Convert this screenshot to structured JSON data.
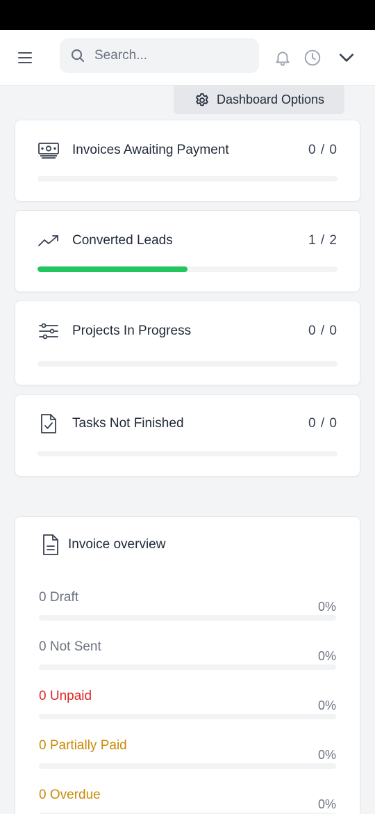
{
  "header": {
    "search_placeholder": "Search...",
    "icons": [
      "menu-icon",
      "search-icon",
      "bell-icon",
      "clock-icon",
      "chevron-down-icon"
    ]
  },
  "dashboard_options": {
    "label": "Dashboard Options",
    "icon": "gear-icon"
  },
  "stats": [
    {
      "label": "Invoices Awaiting Payment",
      "value": "0 / 0",
      "progress": 0,
      "icon": "money-icon"
    },
    {
      "label": "Converted Leads",
      "value": "1 / 2",
      "progress": 0.5,
      "icon": "trending-up-icon",
      "color": "#22c55e"
    },
    {
      "label": "Projects In Progress",
      "value": "0 / 0",
      "progress": 0,
      "icon": "sliders-icon"
    },
    {
      "label": "Tasks Not Finished",
      "value": "0 / 0",
      "progress": 0,
      "icon": "task-file-icon"
    }
  ],
  "invoice_overview": {
    "title": "Invoice overview",
    "icon": "document-icon",
    "items": [
      {
        "label": "0 Draft",
        "percent": "0%",
        "color": "#6b7280"
      },
      {
        "label": "0 Not Sent",
        "percent": "0%",
        "color": "#6b7280"
      },
      {
        "label": "0 Unpaid",
        "percent": "0%",
        "color": "#dc2626"
      },
      {
        "label": "0 Partially Paid",
        "percent": "0%",
        "color": "#ca8a04"
      },
      {
        "label": "0 Overdue",
        "percent": "0%",
        "color": "#ca8a04"
      }
    ]
  }
}
